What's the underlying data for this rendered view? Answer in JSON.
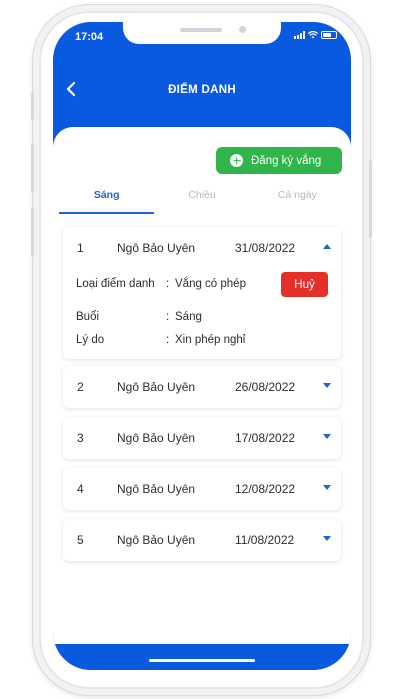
{
  "status_bar": {
    "time": "17:04"
  },
  "header": {
    "title": "ĐIỂM DANH"
  },
  "register_button": {
    "label": "Đăng ký vắng"
  },
  "tabs": [
    {
      "label": "Sáng",
      "active": true
    },
    {
      "label": "Chiều",
      "active": false
    },
    {
      "label": "Cả ngày",
      "active": false
    }
  ],
  "records": [
    {
      "no": "1",
      "name": "Ngô Bảo Uyên",
      "date": "31/08/2022",
      "expanded": true
    },
    {
      "no": "2",
      "name": "Ngô Bảo Uyên",
      "date": "26/08/2022",
      "expanded": false
    },
    {
      "no": "3",
      "name": "Ngô Bảo Uyên",
      "date": "17/08/2022",
      "expanded": false
    },
    {
      "no": "4",
      "name": "Ngô Bảo Uyên",
      "date": "12/08/2022",
      "expanded": false
    },
    {
      "no": "5",
      "name": "Ngô Bảo Uyên",
      "date": "11/08/2022",
      "expanded": false
    }
  ],
  "detail": {
    "type_label": "Loại điểm danh",
    "type_value": "Vắng có phép",
    "session_label": "Buổi",
    "session_value": "Sáng",
    "reason_label": "Lý do",
    "reason_value": "Xin phép nghỉ",
    "separator": ":",
    "cancel_label": "Huỷ"
  },
  "colors": {
    "primary": "#0a5ae0",
    "accent_blue": "#1f63d9",
    "success": "#2fb54a",
    "danger": "#e5302a"
  },
  "icons": {
    "back": "chevron-left-icon",
    "add": "plus-circle-icon",
    "expand": "caret-down-icon",
    "collapse": "caret-up-icon"
  }
}
